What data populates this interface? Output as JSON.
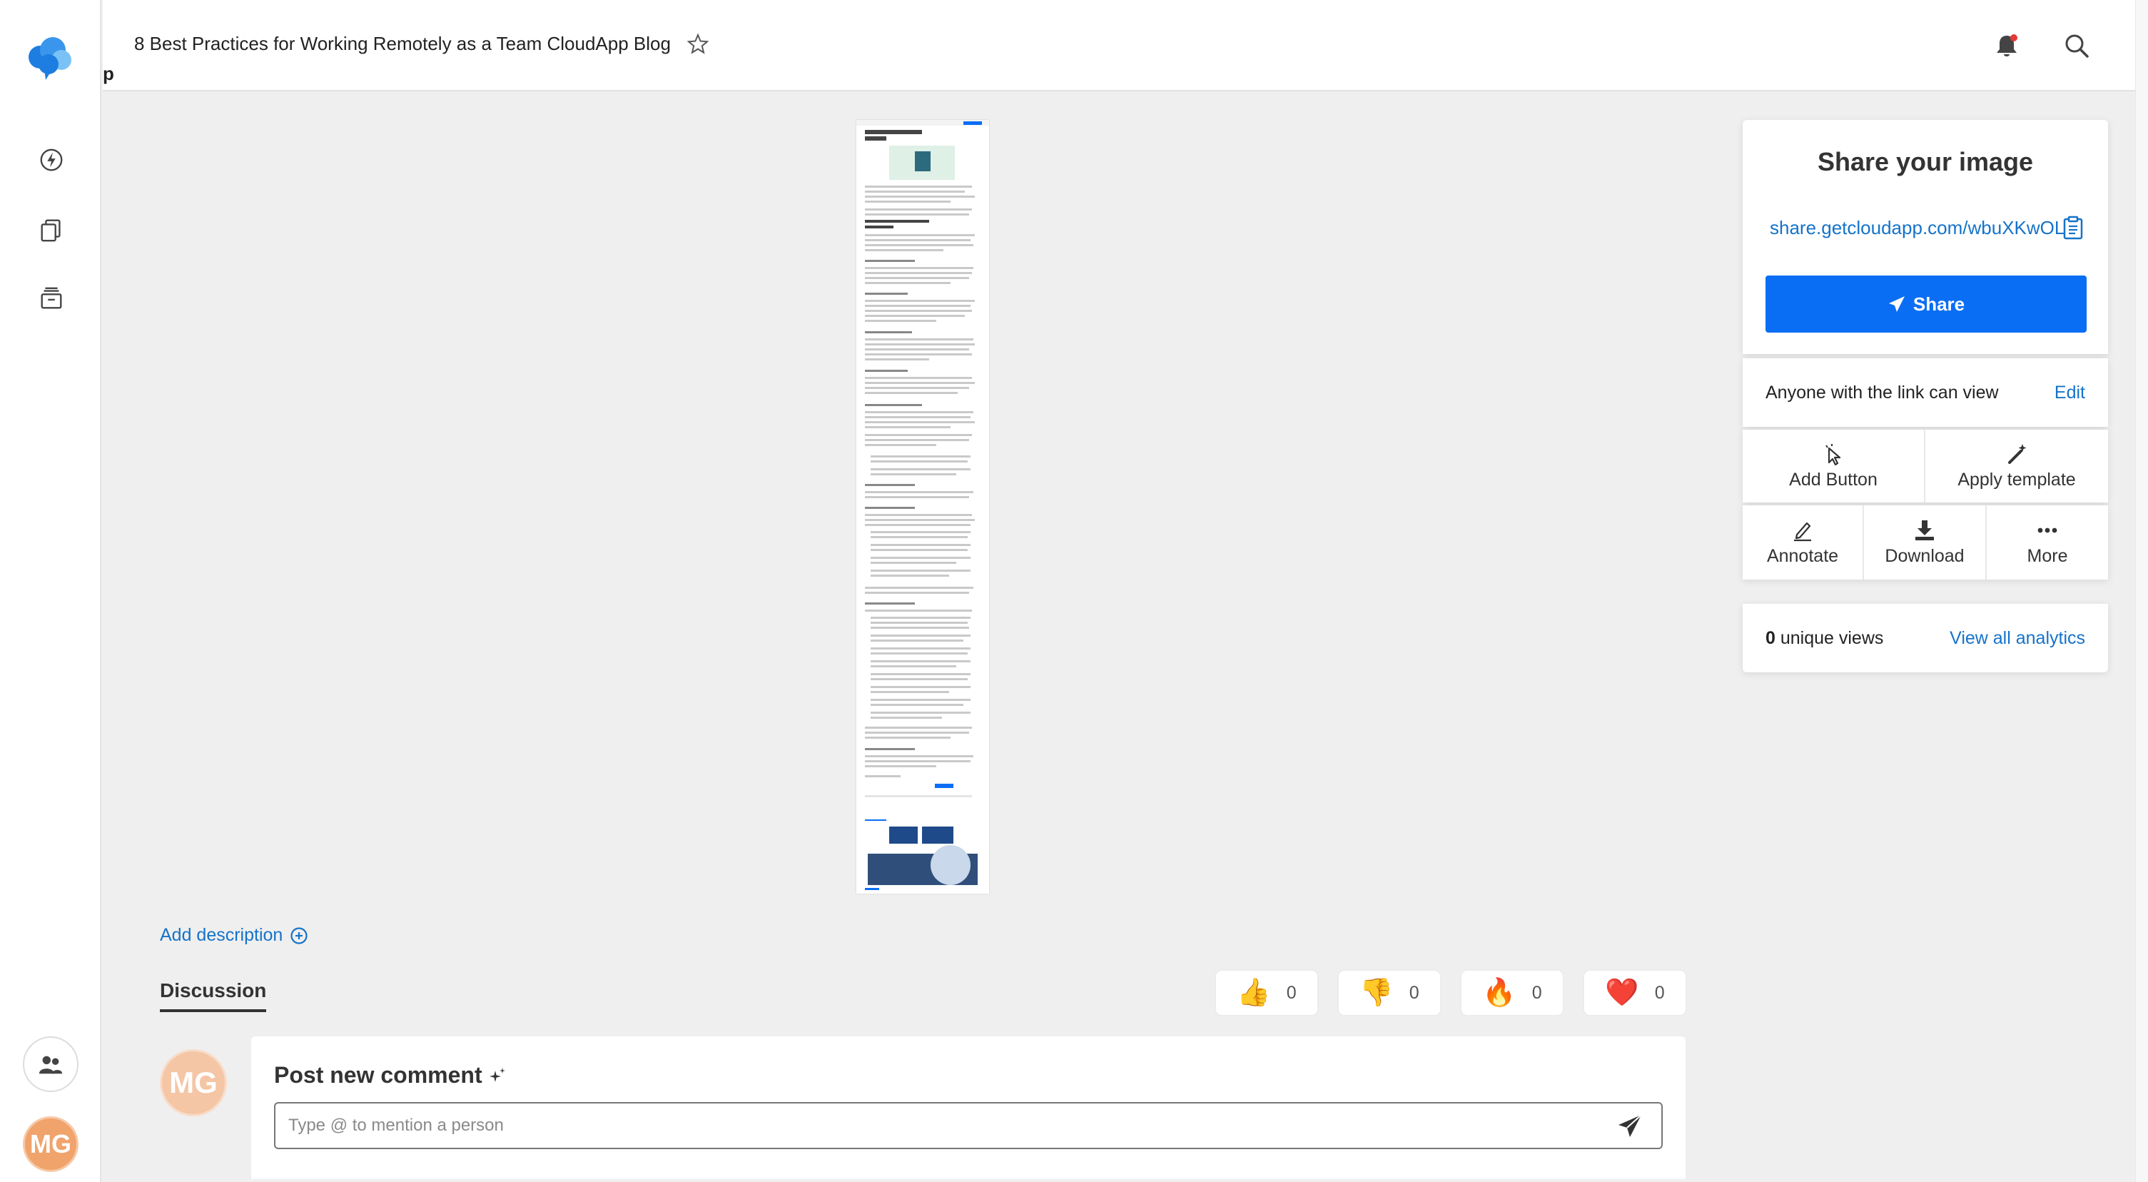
{
  "header": {
    "title": "8 Best Practices for Working Remotely as a Team CloudApp Blog",
    "title_overflow": "p"
  },
  "sidebar": {
    "items": [
      {
        "name": "activity",
        "icon": "lightning-icon"
      },
      {
        "name": "library",
        "icon": "copy-icon"
      },
      {
        "name": "archive",
        "icon": "archive-icon"
      }
    ],
    "team_icon": "team-icon",
    "user_initials": "MG"
  },
  "share_panel": {
    "title": "Share your image",
    "link": "share.getcloudapp.com/wbuXKwOL",
    "share_label": "Share",
    "permission_text": "Anyone with the link can view",
    "edit_label": "Edit",
    "actions_row1": [
      {
        "label": "Add Button",
        "icon": "cursor-click-icon"
      },
      {
        "label": "Apply template",
        "icon": "magic-wand-icon"
      }
    ],
    "actions_row2": [
      {
        "label": "Annotate",
        "icon": "pencil-icon"
      },
      {
        "label": "Download",
        "icon": "download-icon"
      },
      {
        "label": "More",
        "icon": "ellipsis-icon"
      }
    ],
    "views_count": "0",
    "views_label": " unique views",
    "analytics_label": "View all analytics",
    "accent": "#0a6ef5",
    "link_color": "#1573c9"
  },
  "main": {
    "add_description": "Add description",
    "discussion_tab": "Discussion",
    "reactions": [
      {
        "emoji": "👍",
        "count": "0"
      },
      {
        "emoji": "👎",
        "count": "0"
      },
      {
        "emoji": "🔥",
        "count": "0"
      },
      {
        "emoji": "❤️",
        "count": "0"
      }
    ],
    "comment": {
      "avatar_initials": "MG",
      "title": "Post new comment",
      "placeholder": "Type @ to mention a person"
    }
  }
}
